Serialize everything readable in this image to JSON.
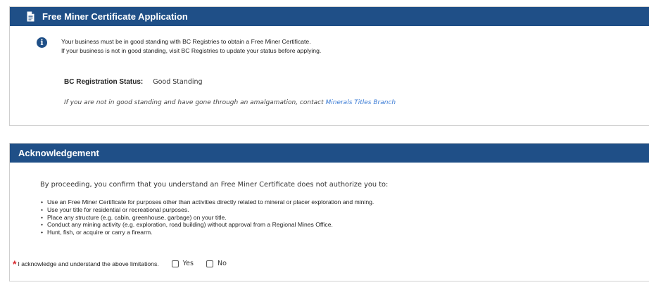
{
  "certificate_panel": {
    "title": "Free Miner Certificate Application",
    "info_line1": "Your business must be in good standing with BC Registries to obtain a Free Miner Certificate.",
    "info_line2": "If your business is not in good standing, visit BC Registries to update your status before applying.",
    "status_label": "BC Registration Status:",
    "status_value": "Good Standing",
    "amalgamation_text": "If you are not in good standing and have gone through an amalgamation, contact ",
    "amalgamation_link": "Minerals Titles Branch"
  },
  "acknowledgement_panel": {
    "title": "Acknowledgement",
    "intro": "By proceeding, you confirm that you understand an Free Miner Certificate does not authorize you to:",
    "items": [
      "Use an Free Miner Certificate for purposes other than activities directly related to mineral or placer exploration and mining.",
      "Use your title for residential or recreational purposes.",
      "Place any structure (e.g. cabin, greenhouse, garbage) on your title.",
      "Conduct any mining activity (e.g. exploration, road building) without approval from a Regional Mines Office.",
      "Hunt, fish, or acquire or carry a firearm."
    ],
    "confirm_label": "I acknowledge and understand the above limitations.",
    "yes_label": "Yes",
    "no_label": "No"
  },
  "colors": {
    "header_bg": "#1f4f87",
    "required": "#d8292f",
    "link": "#3a7bd5"
  },
  "icons": {
    "header": "document-icon",
    "info": "info-icon",
    "required": "required-asterisk-icon"
  }
}
